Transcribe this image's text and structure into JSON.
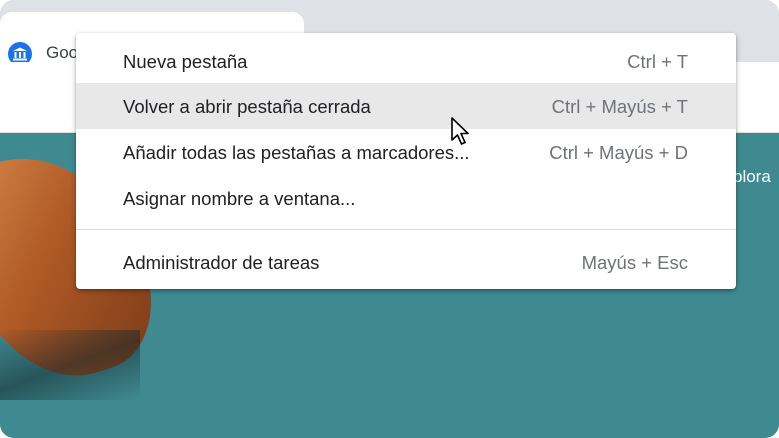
{
  "tab": {
    "title": "Goo",
    "favicon": "bank-icon"
  },
  "content": {
    "partial_text": "plora"
  },
  "context_menu": {
    "items": [
      {
        "label": "Nueva pestaña",
        "shortcut": "Ctrl + T",
        "highlighted": false
      },
      {
        "label": "Volver a abrir pestaña cerrada",
        "shortcut": "Ctrl + Mayús + T",
        "highlighted": true
      },
      {
        "label": "Añadir todas las pestañas a marcadores...",
        "shortcut": "Ctrl + Mayús + D",
        "highlighted": false
      },
      {
        "label": "Asignar nombre a ventana...",
        "shortcut": "",
        "highlighted": false
      },
      {
        "label": "Administrador de tareas",
        "shortcut": "Mayús + Esc",
        "highlighted": false
      }
    ]
  },
  "colors": {
    "highlight": "#e8e8e9",
    "content_bg": "#3f8a91",
    "favicon": "#1a73e8"
  }
}
